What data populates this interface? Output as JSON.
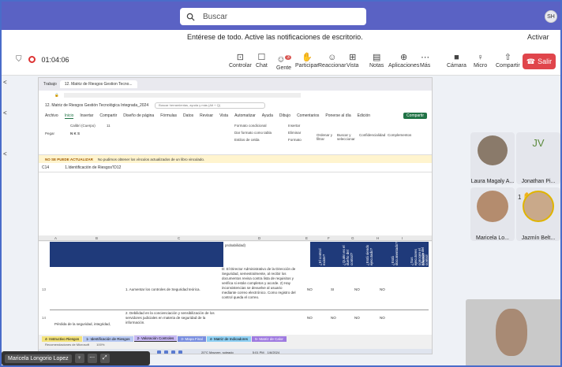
{
  "search": {
    "placeholder": "Buscar"
  },
  "account": {
    "initials": "SH"
  },
  "notification": {
    "message": "Entérese de todo. Active las notificaciones de escritorio.",
    "action": "Activar"
  },
  "meeting": {
    "timer": "01:04:06",
    "controls": [
      {
        "label": "Controlar",
        "icon": "control-icon"
      },
      {
        "label": "Chat",
        "icon": "chat-icon"
      },
      {
        "label": "Gente",
        "icon": "people-icon",
        "badge": "3"
      },
      {
        "label": "Participar",
        "icon": "raise-hand-icon"
      },
      {
        "label": "Reaccionar",
        "icon": "reaction-icon"
      },
      {
        "label": "Vista",
        "icon": "view-icon"
      },
      {
        "label": "Notas",
        "icon": "notes-icon"
      },
      {
        "label": "Aplicaciones",
        "icon": "apps-icon"
      },
      {
        "label": "Más",
        "icon": "more-icon"
      },
      {
        "label": "Cámara",
        "icon": "camera-icon"
      },
      {
        "label": "Micro",
        "icon": "mic-icon"
      },
      {
        "label": "Compartir",
        "icon": "share-icon"
      }
    ],
    "leave_label": "Salir"
  },
  "excel": {
    "tab_label": "12. Matriz de Riesgos Gestion Tecno...",
    "profile_label": "Trabajo",
    "file_title": "12. Matriz de Riesgos Gestión Tecnológica Integrada_2024",
    "search_placeholder": "Buscar herramientas, ayuda y más (Alt + Q)",
    "menu": [
      "Archivo",
      "Inicio",
      "Insertar",
      "Compartir",
      "Diseño de página",
      "Fórmulas",
      "Datos",
      "Revisar",
      "Vista",
      "Automatizar",
      "Ayuda",
      "Dibujo"
    ],
    "active_menu": "Inicio",
    "right_menu": [
      "Comentarios",
      "Ponerse al día",
      "Edición"
    ],
    "share_label": "Compartir",
    "ribbon": {
      "font": "Calibri (Cuerpo)",
      "size": "11",
      "paste": "Pegar",
      "conditional": "Formato condicional",
      "as_table": "Dar formato como tabla",
      "cell_styles": "Estilos de celda",
      "insert": "Insertar",
      "delete": "Eliminar",
      "format": "Formato",
      "sort": "Ordenar y filtrar",
      "find": "Buscar y seleccionar",
      "sensitivity": "Confidencialidad",
      "addins": "Complementos"
    },
    "warning_title": "NO SE PUEDE ACTUALIZAR",
    "warning_text": "No pudimos obtener los vínculos actualizados de un libro vinculado.",
    "cell_ref": "C14",
    "formula": "1.Identificación de Riesgos'!D12",
    "header_text": "probabilidad)",
    "col_letters": [
      "A",
      "B",
      "C",
      "D",
      "E",
      "F",
      "G",
      "H",
      "I"
    ],
    "vertical_headers": [
      "¿El control existe?",
      "¿Quién es el dueño del control?",
      "¿Está siendo ejecutado?",
      "¿Está documentado?",
      "¿Sus ejecutores conocen el control?",
      "Eficacia del control"
    ],
    "rows": [
      {
        "num": "13",
        "control": "1. Aumentar los controles de Seguridad teórica.",
        "detail": "D: El Director Administrativo de la Dirección de Seguridad, semestralmente, al recibir los documentos revisa contra lista de requisitos y verifica si están completos y acorde. 2) Hay inconsistencias se devuelve al usuario mediante correo electrónico. Como registro del control queda el correo.",
        "values": [
          "NO",
          "SI",
          "NO",
          "NO"
        ]
      },
      {
        "num": "14",
        "control": "2. Debilidad en la concienciación y sensibilización de los servidores judiciales en materia de seguridad de la información.",
        "detail": "",
        "values": [
          "NO",
          "NO",
          "NO",
          "NO"
        ]
      }
    ],
    "risk_text": "Pérdida de la seguridad, integridad,",
    "sheets": [
      "4- Instructivo Riesgos",
      "1- Identificación de Riesgos",
      "2- Valoración Controles",
      "3- Mapa Final",
      "4- Matriz de Indicadores",
      "5- Matriz de Calor"
    ],
    "active_sheet": "2- Valoración Controles",
    "zoom": "100%",
    "status_right": "Recomendaciones de Microsoft",
    "weather": "20°C Mayorm. soleado",
    "clock_time": "5:01 PM",
    "clock_date": "1/6/2024"
  },
  "participants": [
    {
      "name": "Laura Magaly A...",
      "type": "photo"
    },
    {
      "name": "Jonathan Pi...",
      "type": "initials",
      "initials": "JV"
    },
    {
      "name": "Maricela Lo...",
      "type": "photo"
    },
    {
      "name": "Jazmín Belt...",
      "type": "photo",
      "hand": "1"
    }
  ],
  "bottom": {
    "name": "Maricela Longorio Lopez"
  }
}
